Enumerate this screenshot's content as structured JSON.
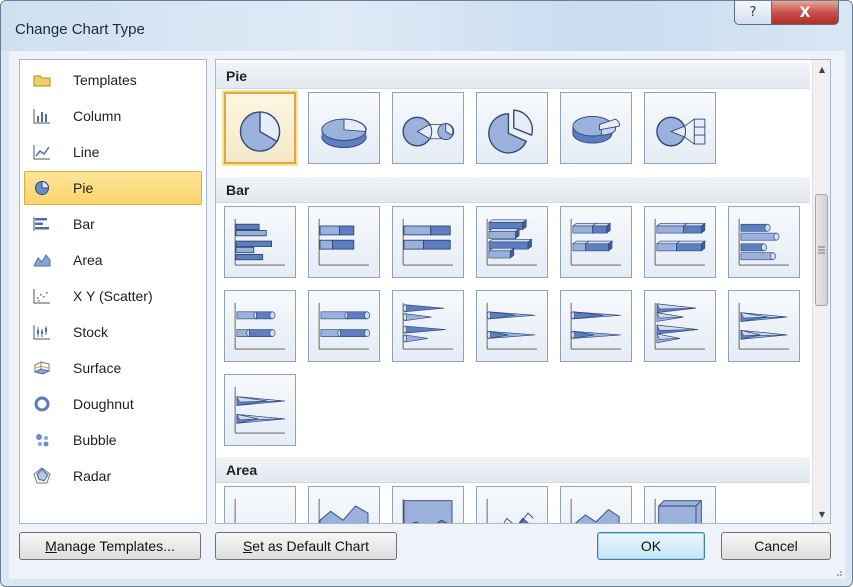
{
  "window": {
    "title": "Change Chart Type"
  },
  "titlebar": {
    "help_glyph": "?",
    "close_glyph": "X"
  },
  "categories": [
    {
      "label": "Templates",
      "icon": "folder-icon"
    },
    {
      "label": "Column",
      "icon": "column-chart-icon"
    },
    {
      "label": "Line",
      "icon": "line-chart-icon"
    },
    {
      "label": "Pie",
      "icon": "pie-chart-icon",
      "selected": true
    },
    {
      "label": "Bar",
      "icon": "bar-chart-icon"
    },
    {
      "label": "Area",
      "icon": "area-chart-icon"
    },
    {
      "label": "X Y (Scatter)",
      "icon": "scatter-chart-icon"
    },
    {
      "label": "Stock",
      "icon": "stock-chart-icon"
    },
    {
      "label": "Surface",
      "icon": "surface-chart-icon"
    },
    {
      "label": "Doughnut",
      "icon": "doughnut-chart-icon"
    },
    {
      "label": "Bubble",
      "icon": "bubble-chart-icon"
    },
    {
      "label": "Radar",
      "icon": "radar-chart-icon"
    }
  ],
  "sections": {
    "pie": {
      "title": "Pie",
      "selected_index": 0,
      "subtypes": [
        "pie",
        "pie-3d",
        "pie-of-pie",
        "exploded-pie",
        "exploded-pie-3d",
        "bar-of-pie"
      ]
    },
    "bar": {
      "title": "Bar",
      "subtypes": [
        "clustered-bar",
        "stacked-bar",
        "100-stacked-bar",
        "clustered-bar-3d",
        "stacked-bar-3d",
        "100-stacked-bar-3d",
        "clustered-horizontal-cylinder",
        "stacked-horizontal-cylinder",
        "100-stacked-horizontal-cylinder",
        "clustered-horizontal-cone",
        "stacked-horizontal-cone",
        "100-stacked-horizontal-cone",
        "clustered-horizontal-pyramid",
        "stacked-horizontal-pyramid",
        "100-stacked-horizontal-pyramid"
      ]
    },
    "area": {
      "title": "Area",
      "subtypes": [
        "area",
        "stacked-area",
        "100-stacked-area",
        "area-3d",
        "stacked-area-3d",
        "100-stacked-area-3d"
      ]
    }
  },
  "buttons": {
    "manage_templates": "Manage Templates...",
    "set_default_prefix": "S",
    "set_default_rest": "et as Default Chart",
    "manage_prefix": "M",
    "manage_rest": "anage Templates...",
    "ok": "OK",
    "cancel": "Cancel"
  },
  "colors": {
    "accent": "#4f6fa6",
    "selection": "#fbd46b",
    "chart_fill": "#4f6fa6"
  }
}
